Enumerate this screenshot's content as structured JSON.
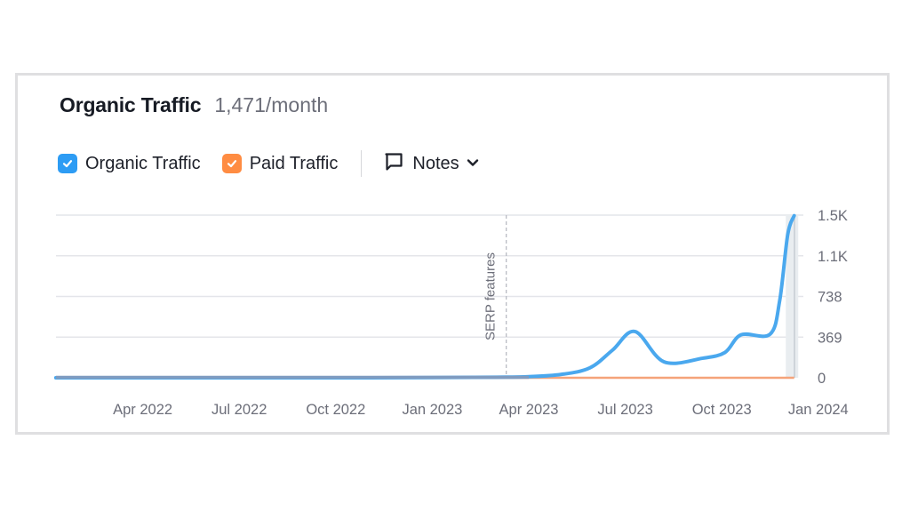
{
  "header": {
    "title": "Organic Traffic",
    "subtitle": "1,471/month"
  },
  "legend": {
    "items": [
      {
        "label": "Organic Traffic",
        "color": "#2d9cf4",
        "checked": true,
        "icon": "checkbox-checked-icon"
      },
      {
        "label": "Paid Traffic",
        "color": "#ff8c42",
        "checked": true,
        "icon": "checkbox-checked-icon"
      }
    ],
    "notes_label": "Notes",
    "notes_icon": "comment-icon",
    "notes_chevron": "chevron-down-icon"
  },
  "chart_data": {
    "type": "line",
    "title": "Organic Traffic",
    "xlabel": "",
    "ylabel": "",
    "ylim": [
      0,
      1476
    ],
    "y_ticks": [
      {
        "value": 0,
        "label": "0"
      },
      {
        "value": 369,
        "label": "369"
      },
      {
        "value": 738,
        "label": "738"
      },
      {
        "value": 1107,
        "label": "1.1K"
      },
      {
        "value": 1476,
        "label": "1.5K"
      }
    ],
    "x_ticks": [
      {
        "month": 3,
        "label": "Apr 2022"
      },
      {
        "month": 6,
        "label": "Jul 2022"
      },
      {
        "month": 9,
        "label": "Oct 2022"
      },
      {
        "month": 12,
        "label": "Jan 2023"
      },
      {
        "month": 15,
        "label": "Apr 2023"
      },
      {
        "month": 18,
        "label": "Jul 2023"
      },
      {
        "month": 21,
        "label": "Oct 2023"
      },
      {
        "month": 24,
        "label": "Jan 2024"
      }
    ],
    "x_unit": "months since Jan 2022",
    "xlim": [
      0.3,
      23.25
    ],
    "grid": true,
    "legend_position": "top-left",
    "annotations": [
      {
        "month": 14.3,
        "label": "SERP features",
        "style": "dashed-vertical"
      }
    ],
    "highlight_month": 23.1,
    "series": [
      {
        "name": "Organic Traffic",
        "color": "#4aa8ee",
        "x": [
          0.3,
          3,
          6,
          9,
          12,
          14,
          15,
          16,
          16.9,
          17.6,
          18.3,
          19.2,
          20.4,
          21.1,
          21.6,
          22.5,
          22.8,
          23.05,
          23.25
        ],
        "y": [
          0,
          0,
          0,
          0,
          2,
          5,
          10,
          30,
          90,
          250,
          420,
          145,
          177,
          230,
          390,
          395,
          700,
          1300,
          1471
        ]
      },
      {
        "name": "Paid Traffic",
        "color": "#f5a37a",
        "x": [
          0.3,
          23.25
        ],
        "y": [
          0,
          0
        ]
      }
    ]
  }
}
